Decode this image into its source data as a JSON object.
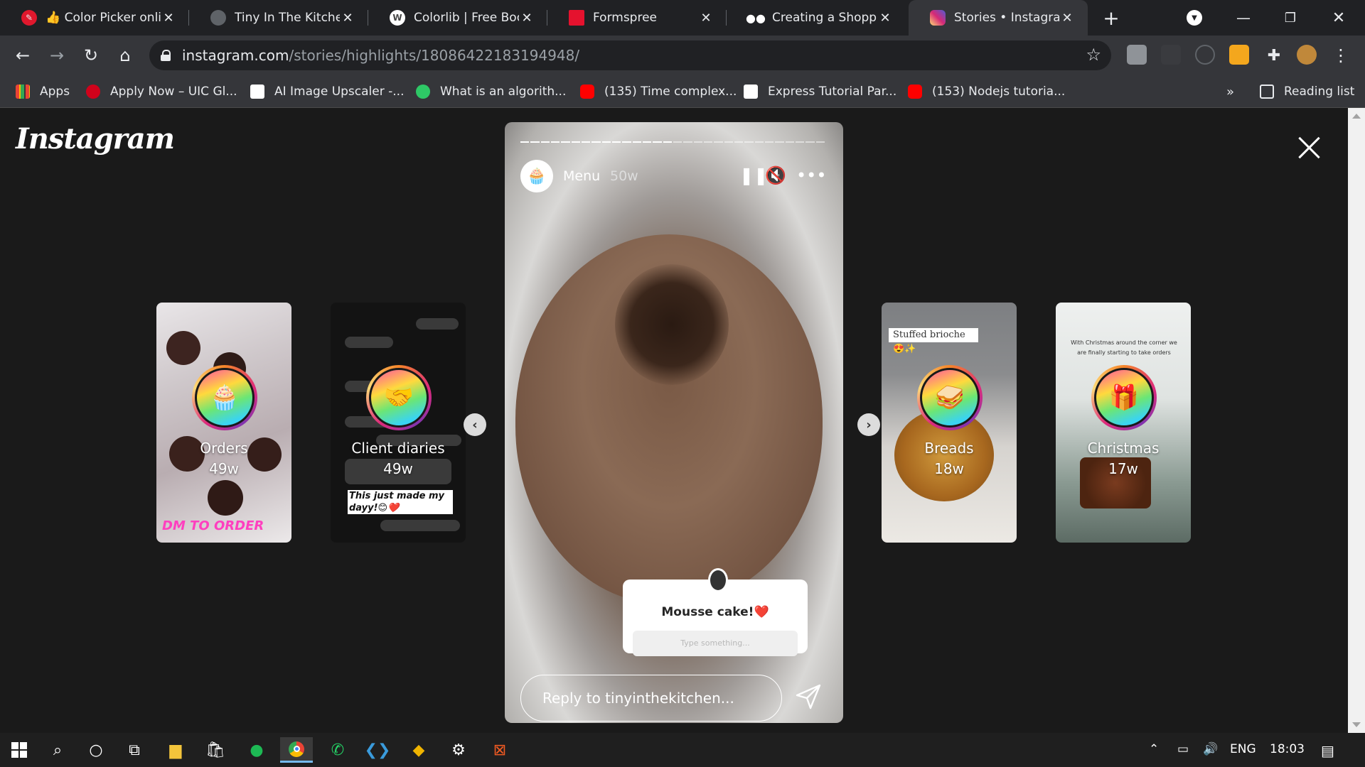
{
  "browser": {
    "tabs": [
      {
        "title": "👍 Color Picker onli",
        "icon": "color-picker-icon",
        "color": "#e0182d"
      },
      {
        "title": "Tiny In The Kitchen",
        "icon": "globe-icon",
        "color": "#9aa0a6"
      },
      {
        "title": "Colorlib | Free Boots",
        "icon": "wordpress-icon",
        "color": "#ffffff"
      },
      {
        "title": "Formspree",
        "icon": "formspree-icon",
        "color": "#e5122e"
      },
      {
        "title": "Creating a Shoppin",
        "icon": "medium-icon",
        "color": "#ffffff"
      },
      {
        "title": "Stories • Instagram",
        "icon": "instagram-icon",
        "color": "#d6249f"
      }
    ],
    "url_host": "instagram.com",
    "url_path": "/stories/highlights/18086422183194948/",
    "bookmarks": [
      {
        "label": "Apps",
        "color": "#ea4335"
      },
      {
        "label": "Apply Now – UIC Gl...",
        "color": "#d0021b"
      },
      {
        "label": "AI Image Upscaler -...",
        "color": "#ffffff"
      },
      {
        "label": "What is an algorith...",
        "color": "#2ec866"
      },
      {
        "label": "(135) Time complex...",
        "color": "#ff0000"
      },
      {
        "label": "Express Tutorial Par...",
        "color": "#ffffff"
      },
      {
        "label": "(153) Nodejs tutoria...",
        "color": "#ff0000"
      }
    ],
    "more": "»",
    "reading_list": "Reading list"
  },
  "instagram": {
    "logo": "Instagram",
    "story": {
      "name": "Menu",
      "age": "50w",
      "question": "Mousse cake!❤️",
      "question_placeholder": "Type something...",
      "reply_placeholder": "Reply to tinyinthekitchen..."
    },
    "highlights": [
      {
        "name": "Orders",
        "age": "49w",
        "icon": "cupcake-icon"
      },
      {
        "name": "Client diaries",
        "age": "49w",
        "icon": "handshake-icon"
      },
      {
        "name": "Breads",
        "age": "18w",
        "icon": "sandwich-icon"
      },
      {
        "name": "Christmas",
        "age": "17w",
        "icon": "gift-icon"
      }
    ],
    "orders_banner": "DM TO ORDER",
    "breads_caption": "Stuffed brioche 😍✨",
    "client_text": "This just made my dayy!😊❤️",
    "christmas_text": "With Christmas around the corner we are finally starting to take orders"
  },
  "taskbar": {
    "lang": "ENG",
    "time": "18:03"
  }
}
